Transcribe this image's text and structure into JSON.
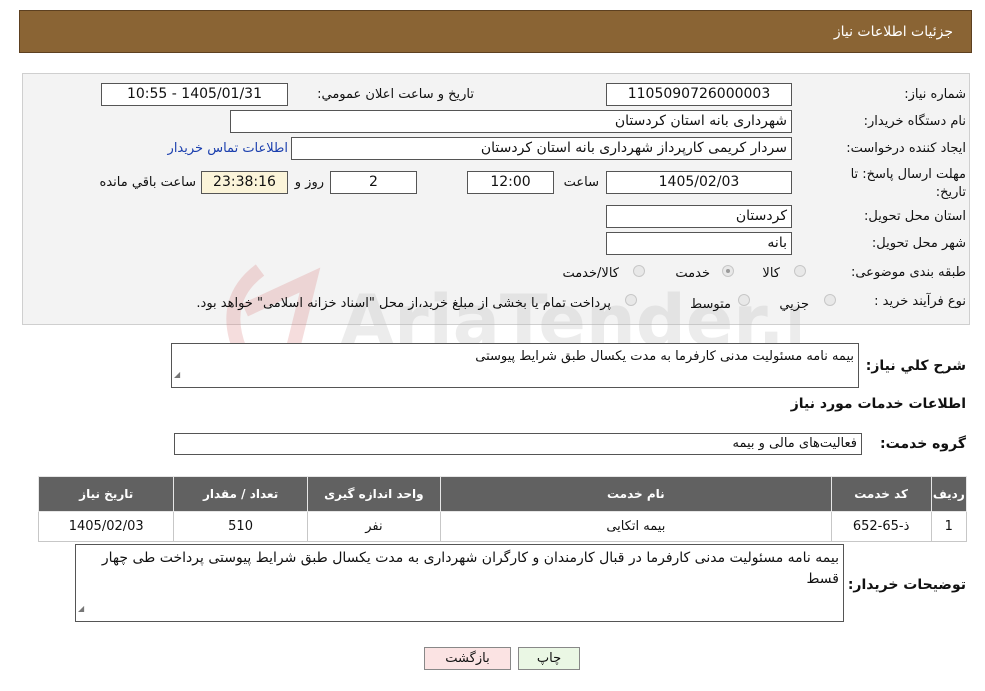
{
  "header": {
    "title": "جزئیات اطلاعات نیاز"
  },
  "form": {
    "need_number_label": "شماره نیاز:",
    "need_number": "1105090726000003",
    "announce_label": "تاریخ و ساعت اعلان عمومي:",
    "announce_value": "1405/01/31 - 10:55",
    "buyer_org_label": "نام دستگاه خريدار:",
    "buyer_org": "شهرداری بانه استان کردستان",
    "creator_label": "ايجاد کننده درخواست:",
    "creator": "سردار کریمی کارپرداز شهرداری بانه استان کردستان",
    "contact_link": "اطلاعات تماس خريدار",
    "deadline_label": "مهلت ارسال پاسخ: تا تاريخ:",
    "deadline_date": "1405/02/03",
    "time_label": "ساعت",
    "deadline_time": "12:00",
    "days": "2",
    "days_label": "روز و",
    "remaining": "23:38:16",
    "remaining_label": "ساعت باقي مانده",
    "province_label": "استان محل تحويل:",
    "province": "کردستان",
    "city_label": "شهر محل تحويل:",
    "city": "بانه",
    "category_label": "طبقه بندی موضوعی:",
    "category_options": [
      "کالا",
      "خدمت",
      "کالا/خدمت"
    ],
    "category_selected": "خدمت",
    "process_label": "نوع فرآيند خريد :",
    "process_options": [
      "جزيي",
      "متوسط"
    ],
    "process_note": "پرداخت تمام یا بخشی از مبلغ خرید،از محل \"اسناد خزانه اسلامی\" خواهد بود."
  },
  "summary": {
    "label": "شرح كلي نياز:",
    "value": "بیمه نامه مسئولیت مدنی کارفرما به مدت یکسال طبق شرایط پیوستی"
  },
  "services": {
    "section_title": "اطلاعات خدمات مورد نياز",
    "group_label": "گروه خدمت:",
    "group_value": "فعالیت‌های مالی و بیمه",
    "columns": [
      "رديف",
      "کد خدمت",
      "نام خدمت",
      "واحد اندازه گيری",
      "تعداد / مقدار",
      "تاريخ نياز"
    ],
    "rows": [
      [
        "1",
        "ذ-65-652",
        "بیمه اتکایی",
        "نفر",
        "510",
        "1405/02/03"
      ]
    ]
  },
  "buyer_notes": {
    "label": "توضيحات خريدار:",
    "value": "بیمه نامه مسئولیت مدنی کارفرما در قبال کارمندان و کارگران شهرداری به مدت یکسال طبق شرایط پیوستی پرداخت طی چهار قسط"
  },
  "buttons": {
    "print": "چاپ",
    "back": "بازگشت"
  },
  "watermark": {
    "text": "AriaTender.neT"
  },
  "colors": {
    "header_bg": "#8a6434",
    "table_header_bg": "#616161",
    "link": "#1b3fae",
    "back_button_bg": "#fbe3e3",
    "print_button_bg": "#eaf7e4"
  }
}
